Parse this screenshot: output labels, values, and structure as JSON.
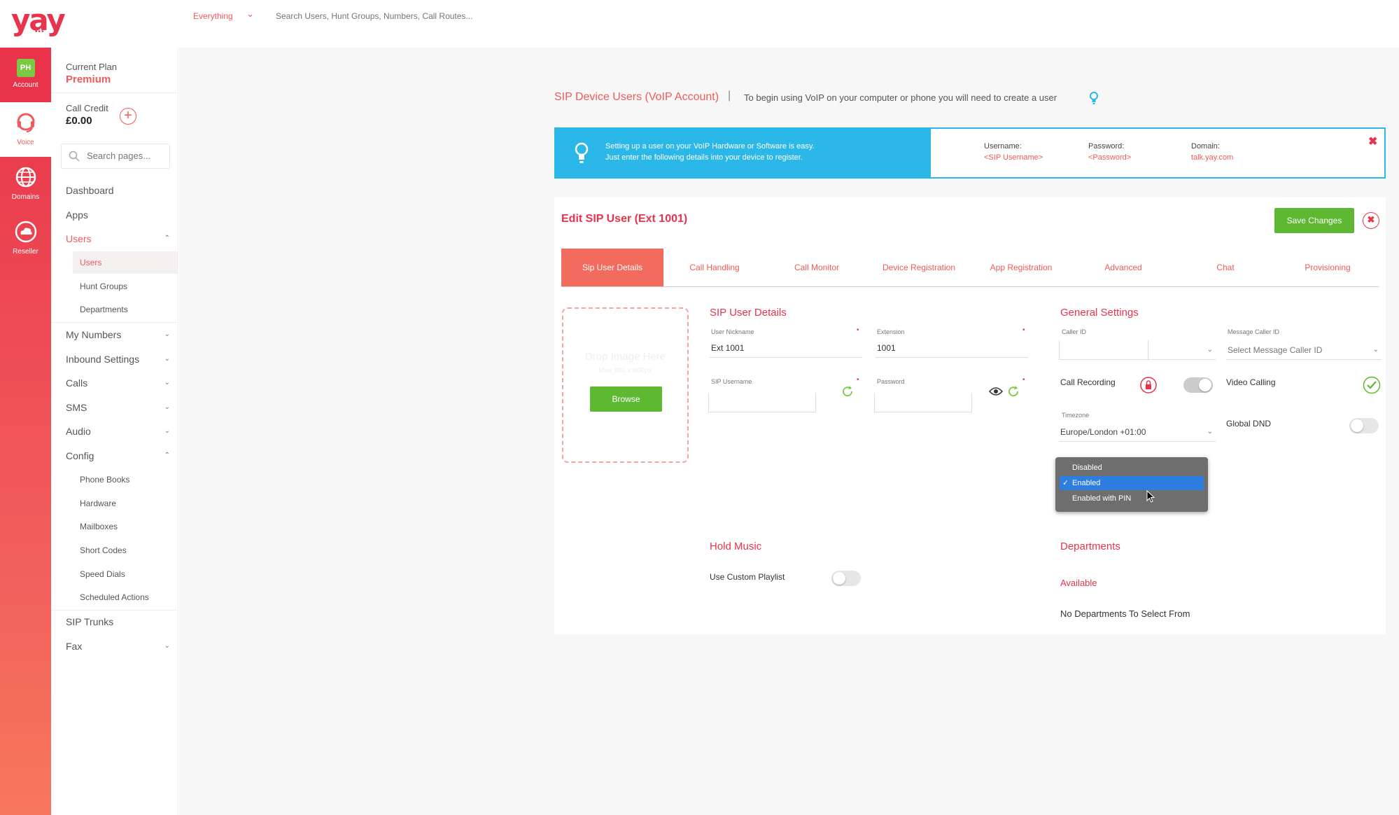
{
  "header": {
    "logo": "yay",
    "logo_dots": "•••",
    "scope": "Everything",
    "search_placeholder": "Search Users, Hunt Groups, Numbers, Call Routes..."
  },
  "rail": {
    "items": [
      {
        "label": "Account",
        "badge": "PH"
      },
      {
        "label": "Voice"
      },
      {
        "label": "Domains"
      },
      {
        "label": "Reseller"
      }
    ]
  },
  "sidebar": {
    "plan_label": "Current Plan",
    "plan_value": "Premium",
    "credit_label": "Call Credit",
    "credit_value": "£0.00",
    "add_credit": "+",
    "search_placeholder": "Search pages...",
    "nav": [
      {
        "label": "Dashboard"
      },
      {
        "label": "Apps"
      },
      {
        "label": "Users",
        "chev": "⌃"
      },
      {
        "label": "My Numbers",
        "chev": "⌄"
      },
      {
        "label": "Inbound Settings",
        "chev": "⌄"
      },
      {
        "label": "Calls",
        "chev": "⌄"
      },
      {
        "label": "SMS",
        "chev": "⌄"
      },
      {
        "label": "Audio",
        "chev": "⌄"
      },
      {
        "label": "Config",
        "chev": "⌃"
      },
      {
        "label": "SIP Trunks"
      },
      {
        "label": "Fax",
        "chev": "⌄"
      }
    ],
    "users_sub": [
      "Users",
      "Hunt Groups",
      "Departments"
    ],
    "config_sub": [
      "Phone Books",
      "Hardware",
      "Mailboxes",
      "Short Codes",
      "Speed Dials",
      "Scheduled Actions"
    ]
  },
  "page": {
    "title": "SIP Device Users (VoIP Account)",
    "separator": "|",
    "info": "To begin using VoIP on your computer or phone you will need to create a user"
  },
  "banner": {
    "line1": "Setting up a user on your VoIP Hardware or Software is easy.",
    "line2": "Just enter the following details into your device to register.",
    "username_label": "Username:",
    "username_value": "<SIP Username>",
    "password_label": "Password:",
    "password_value": "<Password>",
    "domain_label": "Domain:",
    "domain_value": "talk.yay.com",
    "close": "✖"
  },
  "editor": {
    "title": "Edit SIP User (Ext 1001)",
    "save_label": "Save Changes",
    "close": "✖",
    "tabs": [
      "Sip User Details",
      "Call Handling",
      "Call Monitor",
      "Device Registration",
      "App Registration",
      "Advanced",
      "Chat",
      "Provisioning"
    ],
    "dropzone": {
      "text": "Drop Image Here",
      "sub": "Max 800 x 800px",
      "browse": "Browse"
    },
    "sip_details": {
      "title": "SIP User Details",
      "nickname_label": "User Nickname",
      "nickname_value": "Ext 1001",
      "extension_label": "Extension",
      "extension_value": "1001",
      "sip_username_label": "SIP Username",
      "sip_username_value": "",
      "password_label": "Password",
      "password_value": "",
      "required": "•"
    },
    "general": {
      "title": "General Settings",
      "caller_id_label": "Caller ID",
      "caller_id_value": "",
      "message_caller_id_label": "Message Caller ID",
      "message_caller_id_placeholder": "Select Message Caller ID",
      "call_recording_label": "Call Recording",
      "video_calling_label": "Video Calling",
      "timezone_label": "Timezone",
      "timezone_value": "Europe/London +01:00",
      "global_dnd_label": "Global DND"
    },
    "call_recording_options": [
      {
        "label": "Disabled",
        "selected": false
      },
      {
        "label": "Enabled",
        "selected": true
      },
      {
        "label": "Enabled with PIN",
        "selected": false
      }
    ],
    "hold_music": {
      "title": "Hold Music",
      "custom_playlist_label": "Use Custom Playlist"
    },
    "departments": {
      "title": "Departments",
      "available": "Available",
      "empty": "No Departments To Select From"
    }
  },
  "colors": {
    "brand": "#e8334a",
    "accent": "#f05a5a",
    "info_blue": "#2bb8e8",
    "success": "#5fb832",
    "select_blue": "#2e7de1"
  }
}
